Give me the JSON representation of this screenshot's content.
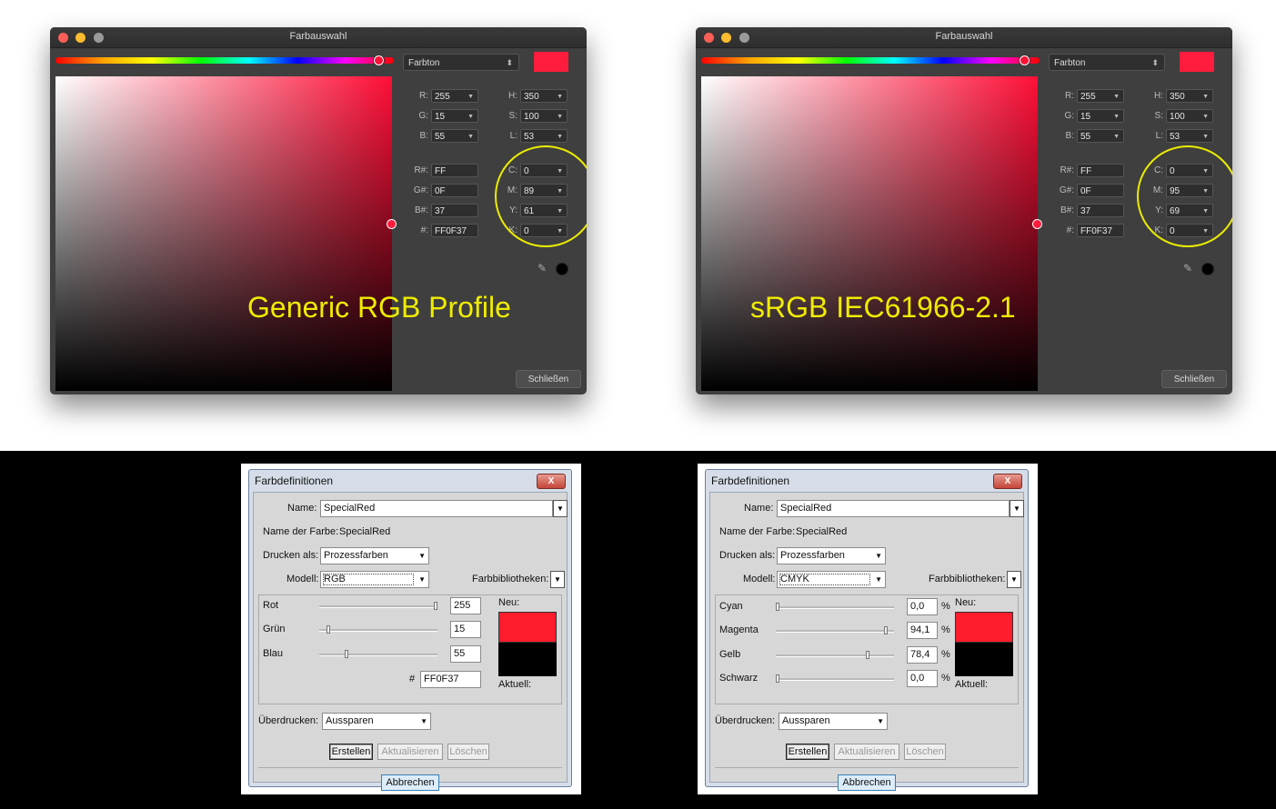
{
  "mac_pickers": [
    {
      "title": "Farbauswahl",
      "mode_select": "Farbton",
      "swatch_color": "#ff1c3c",
      "rgb": {
        "R": "255",
        "G": "15",
        "B": "55"
      },
      "hsl": {
        "H": "350",
        "S": "100",
        "L": "53"
      },
      "hex": {
        "R#": "FF",
        "G#": "0F",
        "B#": "37",
        "#": "FF0F37"
      },
      "cmyk": {
        "C": "0",
        "M": "89",
        "Y": "61",
        "K": "0"
      },
      "close_button": "Schließen",
      "profile_caption": "Generic RGB Profile"
    },
    {
      "title": "Farbauswahl",
      "mode_select": "Farbton",
      "swatch_color": "#ff1c3c",
      "rgb": {
        "R": "255",
        "G": "15",
        "B": "55"
      },
      "hsl": {
        "H": "350",
        "S": "100",
        "L": "53"
      },
      "hex": {
        "R#": "FF",
        "G#": "0F",
        "B#": "37",
        "#": "FF0F37"
      },
      "cmyk": {
        "C": "0",
        "M": "95",
        "Y": "69",
        "K": "0"
      },
      "close_button": "Schließen",
      "profile_caption": "sRGB IEC61966-2.1"
    }
  ],
  "labels": {
    "R": "R:",
    "G": "G:",
    "B": "B:",
    "H": "H:",
    "S": "S:",
    "L": "L:",
    "Rh": "R#:",
    "Gh": "G#:",
    "Bh": "B#:",
    "hash": "#:",
    "C": "C:",
    "M": "M:",
    "Y": "Y:",
    "K": "K:"
  },
  "win_dialogs": [
    {
      "title": "Farbdefinitionen",
      "close_glyph": "X",
      "name_label": "Name:",
      "name_value": "SpecialRed",
      "color_name_label": "Name der Farbe:",
      "color_name_value": "SpecialRed",
      "print_as_label": "Drucken als:",
      "print_as_value": "Prozessfarben",
      "model_label": "Modell:",
      "model_value": "RGB",
      "libraries_label": "Farbbibliotheken:",
      "sliders": [
        {
          "label": "Rot",
          "value": "255",
          "unit": "",
          "level": 1.0
        },
        {
          "label": "Grün",
          "value": "15",
          "unit": "",
          "level": 0.06
        },
        {
          "label": "Blau",
          "value": "55",
          "unit": "",
          "level": 0.22
        }
      ],
      "hex_label": "#",
      "hex_value": "FF0F37",
      "new_label": "Neu:",
      "current_label": "Aktuell:",
      "overprint_label": "Überdrucken:",
      "overprint_value": "Aussparen",
      "btn_create": "Erstellen",
      "btn_update": "Aktualisieren",
      "btn_delete": "Löschen",
      "btn_cancel": "Abbrechen"
    },
    {
      "title": "Farbdefinitionen",
      "close_glyph": "X",
      "name_label": "Name:",
      "name_value": "SpecialRed",
      "color_name_label": "Name der Farbe:",
      "color_name_value": "SpecialRed",
      "print_as_label": "Drucken als:",
      "print_as_value": "Prozessfarben",
      "model_label": "Modell:",
      "model_value": "CMYK",
      "libraries_label": "Farbbibliotheken:",
      "sliders": [
        {
          "label": "Cyan",
          "value": "0,0",
          "unit": "%",
          "level": 0.0
        },
        {
          "label": "Magenta",
          "value": "94,1",
          "unit": "%",
          "level": 0.941
        },
        {
          "label": "Gelb",
          "value": "78,4",
          "unit": "%",
          "level": 0.784
        },
        {
          "label": "Schwarz",
          "value": "0,0",
          "unit": "%",
          "level": 0.0
        }
      ],
      "new_label": "Neu:",
      "current_label": "Aktuell:",
      "overprint_label": "Überdrucken:",
      "overprint_value": "Aussparen",
      "btn_create": "Erstellen",
      "btn_update": "Aktualisieren",
      "btn_delete": "Löschen",
      "btn_cancel": "Abbrechen"
    }
  ]
}
